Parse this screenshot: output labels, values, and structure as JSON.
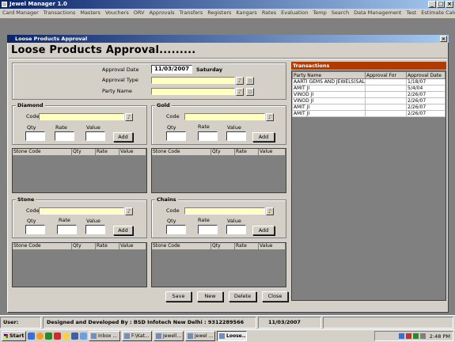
{
  "app": {
    "title": "Jewel Manager 1.0"
  },
  "menu": [
    "Card Manager",
    "Transactions",
    "Masters",
    "Vouchers",
    "ORV",
    "Approvals",
    "Transfers",
    "Registers",
    "Kangars",
    "Rates",
    "Evaluation",
    "Temp",
    "Search",
    "Data Management",
    "Test",
    "Estimate Calculator"
  ],
  "window": {
    "title": "Loose Products Approval",
    "heading": "Loose  Products Approval........."
  },
  "form": {
    "approval_date_label": "Approval Date",
    "approval_date": "11/03/2007",
    "day": "Saturday",
    "approval_type_label": "Approval Type",
    "party_name_label": "Party Name"
  },
  "sections": {
    "diamond": {
      "title": "Diamond",
      "code": "Code",
      "qty": "Qty",
      "rate": "Rate",
      "value": "Value",
      "add": "Add"
    },
    "gold": {
      "title": "Gold",
      "code": "Code",
      "qty": "Qty",
      "rate": "Rate",
      "value": "Value",
      "add": "Add"
    },
    "stone": {
      "title": "Stone",
      "code": "Code",
      "qty": "Qty",
      "rate": "Rate",
      "value": "Value",
      "add": "Add"
    },
    "chains": {
      "title": "Chains",
      "code": "Code",
      "qty": "Qty",
      "rate": "Rate",
      "value": "Value",
      "add": "Add"
    }
  },
  "grid_columns": [
    "Stone Code",
    "Qty",
    "Rate",
    "Value"
  ],
  "buttons": {
    "save": "Save",
    "new": "New",
    "delete": "Delete",
    "close": "Close"
  },
  "transactions": {
    "title": "Transactions",
    "columns": [
      "Party Name",
      "Approval For",
      "Approval Date"
    ],
    "rows": [
      [
        "AARTI GEMS AND JEWELS(SAL",
        "",
        "1/18/07"
      ],
      [
        "AMIT JI",
        "",
        "5/4/04"
      ],
      [
        "VINOD JI",
        "",
        "2/26/07"
      ],
      [
        "VINOD JI",
        "",
        "2/26/07"
      ],
      [
        "AMIT JI",
        "",
        "2/26/07"
      ],
      [
        "AMIT JI",
        "",
        "2/26/07"
      ]
    ]
  },
  "status": {
    "user_label": "User:",
    "developer": "Designed and Developed By : BSD Infotech New Delhi : 9312289566",
    "date": "11/03/2007"
  },
  "taskbar": {
    "start": "Start",
    "tasks": [
      "Inbox ...",
      "F:\\Kat...",
      "Jewell...",
      "Jewel ...",
      "Loose..."
    ],
    "clock": "2:48 PM"
  }
}
